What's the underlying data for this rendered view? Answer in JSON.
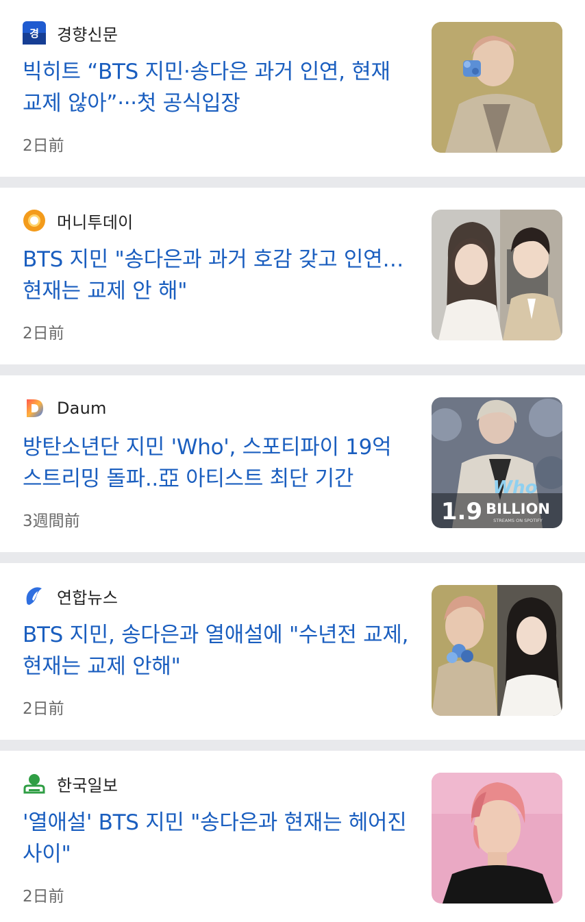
{
  "articles": [
    {
      "source": "경향신문",
      "logo_icon": "kyunghyang-logo-icon",
      "headline": "빅히트 “BTS 지민·송다은 과거 인연, 현재 교제 않아”···첫 공식입장",
      "time": "2日前",
      "thumbnail": "person-beige-suit-photo"
    },
    {
      "source": "머니투데이",
      "logo_icon": "moneytoday-logo-icon",
      "headline": "BTS 지민 \"송다은과 과거 호감 갖고 인연…현재는 교제 안 해\"",
      "time": "2日前",
      "thumbnail": "two-people-photo"
    },
    {
      "source": "Daum",
      "logo_icon": "daum-logo-icon",
      "headline": "방탄소년단 지민 'Who', 스포티파이 19억 스트리밍 돌파..亞 아티스트 최단 기간",
      "time": "3週間前",
      "thumbnail": "who-streams-graphic",
      "thumb_text": {
        "title": "Who",
        "big": "1.9",
        "unit": "BILLION",
        "caption": "STREAMS ON SPOTIFY"
      }
    },
    {
      "source": "연합뉴스",
      "logo_icon": "yonhap-logo-icon",
      "headline": "BTS 지민, 송다은과 열애설에 \"수년전 교제, 현재는 교제 안해\"",
      "time": "2日前",
      "thumbnail": "split-two-person-photo"
    },
    {
      "source": "한국일보",
      "logo_icon": "hankookilbo-logo-icon",
      "headline": "'열애설' BTS 지민 \"송다은과 현재는 헤어진 사이\"",
      "time": "2日前",
      "thumbnail": "person-pink-background-photo"
    }
  ],
  "colors": {
    "headline": "#1a5ebf",
    "separator": "#e8e9ec",
    "time": "#6a6a6a"
  }
}
